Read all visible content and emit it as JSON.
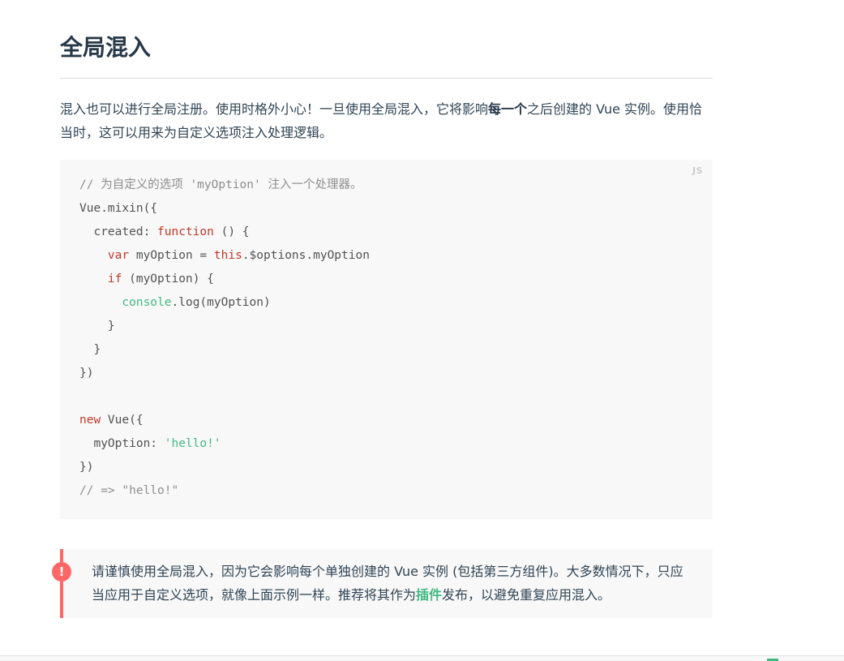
{
  "section": {
    "title": "全局混入"
  },
  "intro": {
    "text_before": "混入也可以进行全局注册。使用时格外小心！一旦使用全局混入，它将影响",
    "emphasis": "每一个",
    "text_after": "之后创建的 Vue 实例。使用恰当时，这可以用来为自定义选项注入处理逻辑。"
  },
  "code": {
    "lang": "JS",
    "lines": [
      [
        {
          "t": "// 为自定义的选项 'myOption' 注入一个处理器。",
          "c": "comment"
        }
      ],
      [
        {
          "t": "Vue.mixin({",
          "c": "plain"
        }
      ],
      [
        {
          "t": "  created: ",
          "c": "plain"
        },
        {
          "t": "function",
          "c": "keyword"
        },
        {
          "t": " () {",
          "c": "plain"
        }
      ],
      [
        {
          "t": "    ",
          "c": "plain"
        },
        {
          "t": "var",
          "c": "keyword"
        },
        {
          "t": " myOption = ",
          "c": "plain"
        },
        {
          "t": "this",
          "c": "keyword"
        },
        {
          "t": ".$options.myOption",
          "c": "plain"
        }
      ],
      [
        {
          "t": "    ",
          "c": "plain"
        },
        {
          "t": "if",
          "c": "keyword"
        },
        {
          "t": " (myOption) {",
          "c": "plain"
        }
      ],
      [
        {
          "t": "      ",
          "c": "plain"
        },
        {
          "t": "console",
          "c": "builtin"
        },
        {
          "t": ".log(myOption)",
          "c": "plain"
        }
      ],
      [
        {
          "t": "    }",
          "c": "plain"
        }
      ],
      [
        {
          "t": "  }",
          "c": "plain"
        }
      ],
      [
        {
          "t": "})",
          "c": "plain"
        }
      ],
      [
        {
          "t": "",
          "c": "plain"
        }
      ],
      [
        {
          "t": "new",
          "c": "keyword"
        },
        {
          "t": " Vue({",
          "c": "plain"
        }
      ],
      [
        {
          "t": "  myOption: ",
          "c": "plain"
        },
        {
          "t": "'hello!'",
          "c": "string"
        }
      ],
      [
        {
          "t": "})",
          "c": "plain"
        }
      ],
      [
        {
          "t": "// => \"hello!\"",
          "c": "comment"
        }
      ]
    ]
  },
  "tip": {
    "icon": "!",
    "text_before": "请谨慎使用全局混入，因为它会影响每个单独创建的 Vue 实例 (包括第三方组件)。大多数情况下，只应当应用于自定义选项，就像上面示例一样。推荐将其作为",
    "link": "插件",
    "text_after": "发布，以避免重复应用混入。"
  },
  "colors": {
    "accent": "#42b983",
    "danger": "#ff6666",
    "keyword": "#c0392b",
    "text": "#304455"
  }
}
